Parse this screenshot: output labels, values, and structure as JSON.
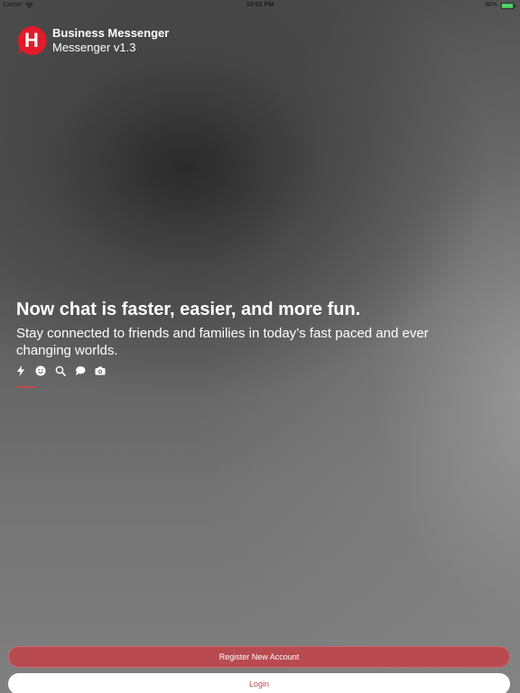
{
  "status_bar": {
    "carrier": "Carrier",
    "time": "10:52 PM",
    "battery": "98%",
    "icons": [
      "wifi-icon",
      "battery-icon"
    ]
  },
  "header": {
    "logo_letter": "H",
    "app_name": "Business Messenger",
    "version": "Messenger v1.3"
  },
  "hero": {
    "headline": "Now chat is faster, easier, and more fun.",
    "subtitle": "Stay connected to friends and families in today’s fast paced and ever changing worlds."
  },
  "features": {
    "icons": [
      "lightning-icon",
      "smiley-icon",
      "search-icon",
      "chat-bubble-icon",
      "camera-icon"
    ]
  },
  "buttons": {
    "register": "Register New Account",
    "login": "Login"
  },
  "colors": {
    "accent": "#b84a50",
    "logo_red": "#e21b2a",
    "text": "#ffffff"
  }
}
